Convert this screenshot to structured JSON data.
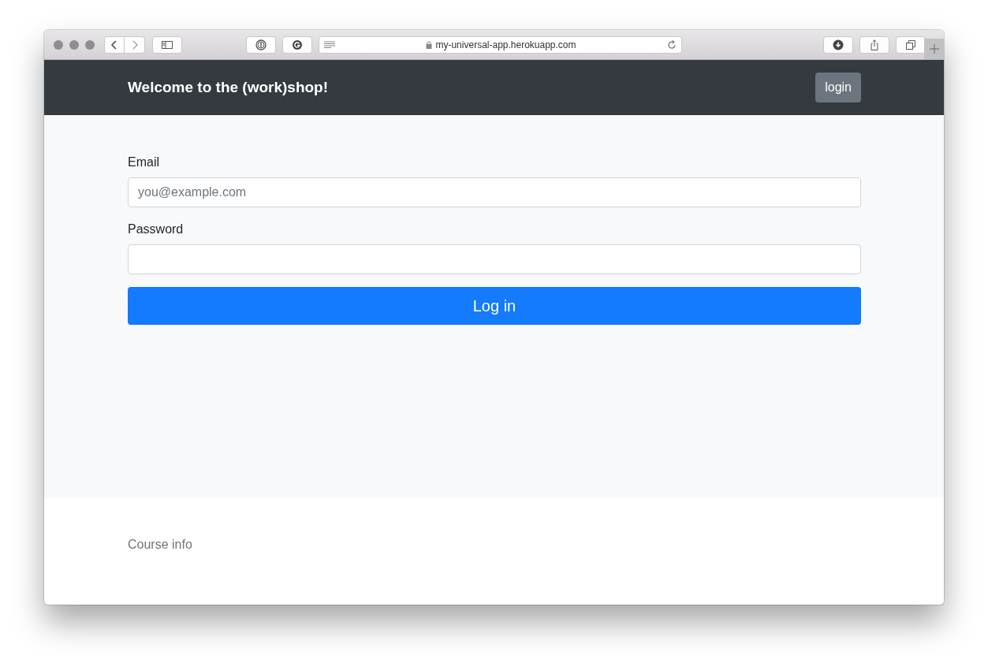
{
  "browser": {
    "url": "my-universal-app.herokuapp.com"
  },
  "navbar": {
    "brand": "Welcome to the (work)shop!",
    "button": "login"
  },
  "form": {
    "fields": [
      {
        "label": "Email",
        "placeholder": "you@example.com"
      },
      {
        "label": "Password"
      }
    ],
    "submit": "Log in"
  },
  "footer": {
    "link": "Course info"
  }
}
